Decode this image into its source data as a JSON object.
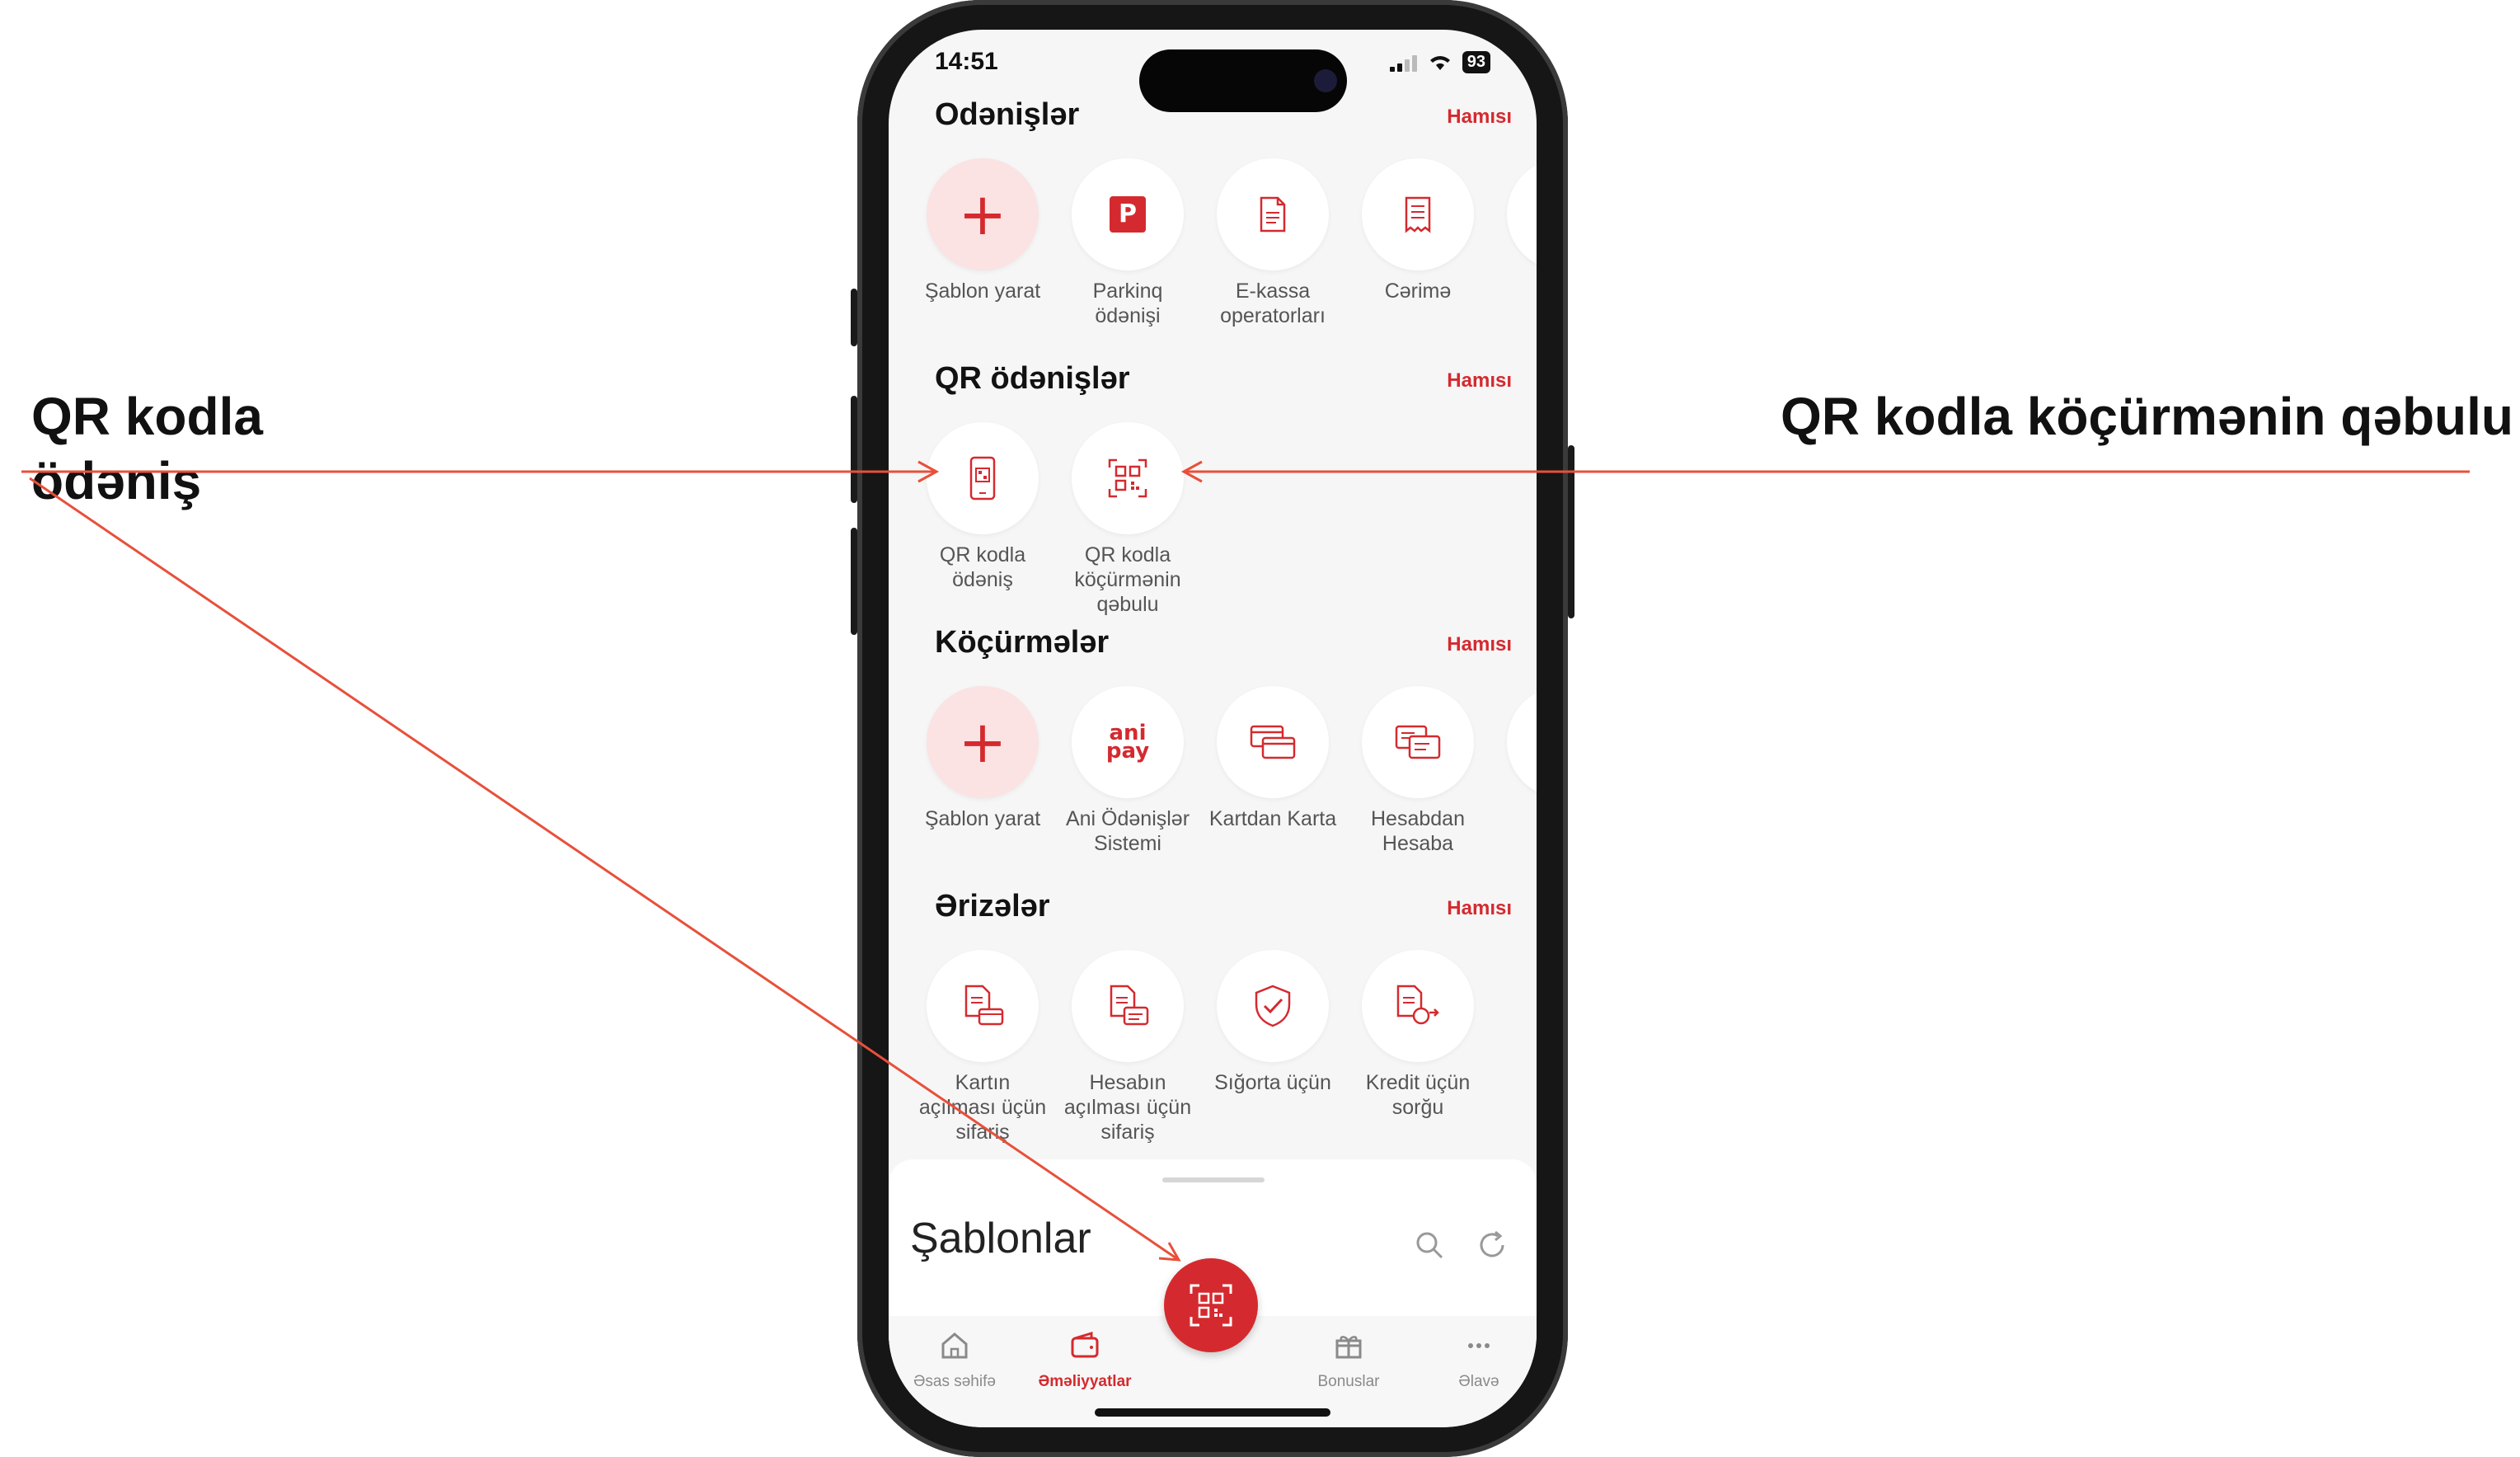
{
  "callouts": {
    "left": "QR kodla\nödəniş",
    "right": "QR kodla köçürmənin qəbulu"
  },
  "colors": {
    "accent": "#d42a2f",
    "annotation_line": "#e8503a",
    "tile_pink": "#fbe2e3"
  },
  "status_bar": {
    "time": "14:51",
    "battery": "93"
  },
  "sections": [
    {
      "title": "Odənişlər",
      "see_all": "Hamısı",
      "items": [
        {
          "label": "Şablon yarat",
          "icon": "plus-icon"
        },
        {
          "label": "Parkinq\nödənişi",
          "icon": "parking-icon",
          "badge": "P"
        },
        {
          "label": "E-kassa\noperatorları",
          "icon": "document-icon"
        },
        {
          "label": "Cərimə",
          "icon": "receipt-icon"
        },
        {
          "label": "",
          "icon": "partial-icon"
        }
      ]
    },
    {
      "title": "QR ödənişlər",
      "see_all": "Hamısı",
      "items": [
        {
          "label": "QR kodla\nödəniş",
          "icon": "phone-qr-icon"
        },
        {
          "label": "QR kodla\nköçürmənin\nqəbulu",
          "icon": "qr-code-icon"
        }
      ]
    },
    {
      "title": "Köçürmələr",
      "see_all": "Hamısı",
      "items": [
        {
          "label": "Şablon yarat",
          "icon": "plus-icon"
        },
        {
          "label": "Ani Ödənişlər\nSistemi",
          "icon": "anipay-icon",
          "logo_text": "ani\npay"
        },
        {
          "label": "Kartdan Karta",
          "icon": "cards-icon"
        },
        {
          "label": "Hesabdan\nHesaba",
          "icon": "accounts-icon"
        },
        {
          "label": "",
          "icon": "partial-icon"
        }
      ]
    },
    {
      "title": "Ərizələr",
      "see_all": "Hamısı",
      "items": [
        {
          "label": "Kartın\naçılması üçün\nsifariş",
          "icon": "card-order-icon"
        },
        {
          "label": "Hesabın\naçılması üçün\nsifariş",
          "icon": "account-order-icon"
        },
        {
          "label": "Sığorta üçün",
          "icon": "shield-check-icon"
        },
        {
          "label": "Kredit üçün\nsorğu",
          "icon": "loan-request-icon"
        }
      ]
    }
  ],
  "templates_sheet": {
    "title": "Şablonlar",
    "search_icon": "search-icon",
    "refresh_icon": "refresh-icon"
  },
  "tab_bar": [
    {
      "label": "Əsas səhifə",
      "icon": "home-icon",
      "active": false
    },
    {
      "label": "Əməliyyatlar",
      "icon": "wallet-icon",
      "active": true
    },
    {
      "label": "Bonuslar",
      "icon": "gift-icon",
      "active": false
    },
    {
      "label": "Əlavə",
      "icon": "more-icon",
      "active": false
    }
  ],
  "fab": {
    "icon": "qr-scan-icon"
  }
}
